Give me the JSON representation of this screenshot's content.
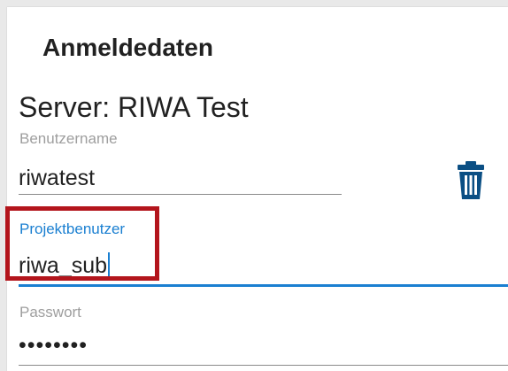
{
  "dialog": {
    "title": "Anmeldedaten",
    "server_label": "Server: RIWA Test"
  },
  "fields": {
    "username": {
      "label": "Benutzername",
      "value": "riwatest"
    },
    "project_user": {
      "label": "Projektbenutzer",
      "value": "riwa_sub"
    },
    "password": {
      "label": "Passwort",
      "value": "••••••••"
    }
  },
  "icons": {
    "delete": "trash-icon"
  },
  "colors": {
    "accent": "#1a7fd1",
    "highlight": "#b3151c",
    "trash": "#0b4f84",
    "text": "#212121",
    "label": "#9e9e9e"
  }
}
